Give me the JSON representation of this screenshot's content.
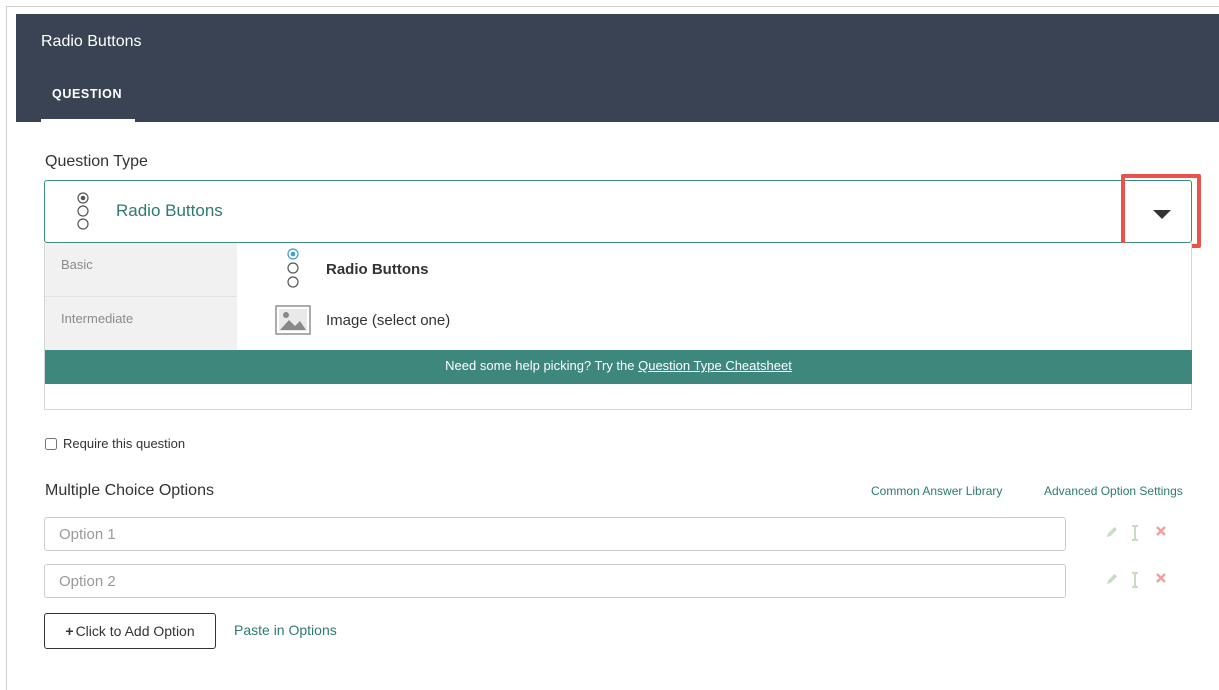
{
  "header": {
    "title": "Radio Buttons",
    "tab": "QUESTION"
  },
  "question_type": {
    "label": "Question Type",
    "selected": "Radio Buttons",
    "categories": [
      "Basic",
      "Intermediate"
    ],
    "options": [
      {
        "label": "Radio Buttons",
        "icon": "radio-buttons-icon"
      },
      {
        "label": "Image (select one)",
        "icon": "image-icon"
      }
    ],
    "help": {
      "text": "Need some help picking? Try the ",
      "link": "Question Type Cheatsheet"
    }
  },
  "require": {
    "label": "Require this question",
    "checked": false
  },
  "multiple_choice": {
    "label": "Multiple Choice Options",
    "links": {
      "library": "Common Answer Library",
      "advanced": "Advanced Option Settings"
    },
    "options": [
      {
        "placeholder": "Option 1"
      },
      {
        "placeholder": "Option 2"
      }
    ],
    "add_button": "Click to Add Option",
    "paste_link": "Paste in Options"
  },
  "colors": {
    "header_bg": "#3a4353",
    "accent": "#3d877d",
    "highlight": "#e8544a",
    "delete": "#f0a0a0"
  }
}
